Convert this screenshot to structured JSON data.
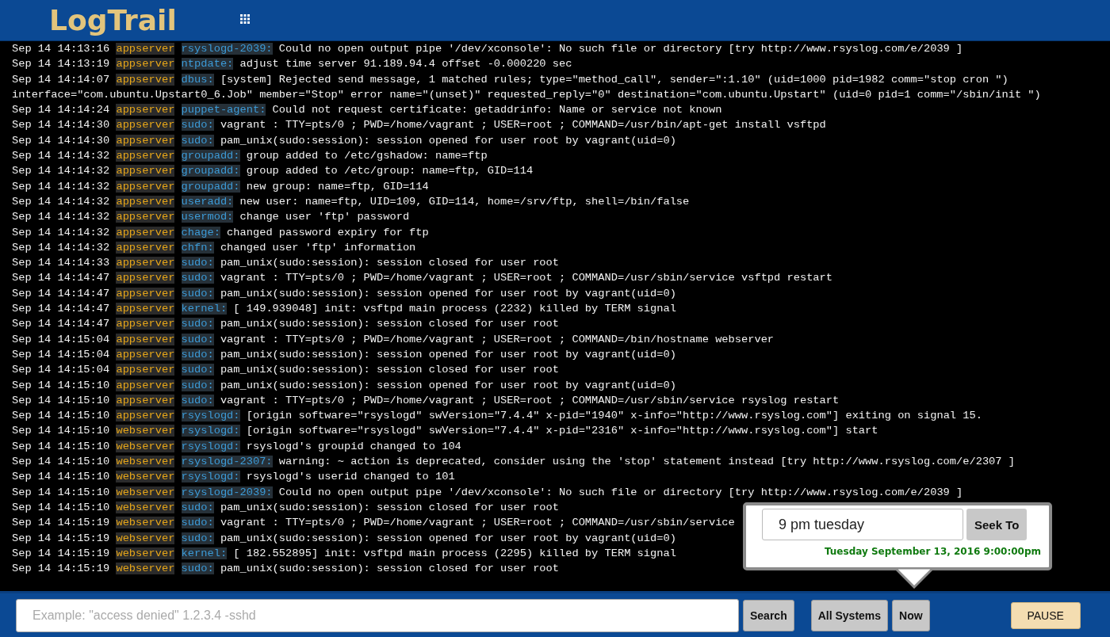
{
  "app": {
    "title": "LogTrail"
  },
  "log": [
    {
      "time": "Sep 14 14:13:16",
      "host": "appserver",
      "program": "rsyslogd-2039:",
      "message": "Could no open output pipe '/dev/xconsole': No such file or directory [try http://www.rsyslog.com/e/2039 ]"
    },
    {
      "time": "Sep 14 14:13:19",
      "host": "appserver",
      "program": "ntpdate:",
      "message": "adjust time server 91.189.94.4 offset -0.000220 sec"
    },
    {
      "time": "Sep 14 14:14:07",
      "host": "appserver",
      "program": "dbus:",
      "message": "[system] Rejected send message, 1 matched rules; type=\"method_call\", sender=\":1.10\" (uid=1000 pid=1982 comm=\"stop cron \")",
      "continuation": "interface=\"com.ubuntu.Upstart0_6.Job\" member=\"Stop\" error name=\"(unset)\" requested_reply=\"0\" destination=\"com.ubuntu.Upstart\" (uid=0 pid=1 comm=\"/sbin/init \")"
    },
    {
      "time": "Sep 14 14:14:24",
      "host": "appserver",
      "program": "puppet-agent:",
      "message": "Could not request certificate: getaddrinfo: Name or service not known"
    },
    {
      "time": "Sep 14 14:14:30",
      "host": "appserver",
      "program": "sudo:",
      "message": "vagrant : TTY=pts/0 ; PWD=/home/vagrant ; USER=root ; COMMAND=/usr/bin/apt-get install vsftpd"
    },
    {
      "time": "Sep 14 14:14:30",
      "host": "appserver",
      "program": "sudo:",
      "message": "pam_unix(sudo:session): session opened for user root by vagrant(uid=0)"
    },
    {
      "time": "Sep 14 14:14:32",
      "host": "appserver",
      "program": "groupadd:",
      "message": "group added to /etc/gshadow: name=ftp"
    },
    {
      "time": "Sep 14 14:14:32",
      "host": "appserver",
      "program": "groupadd:",
      "message": "group added to /etc/group: name=ftp, GID=114"
    },
    {
      "time": "Sep 14 14:14:32",
      "host": "appserver",
      "program": "groupadd:",
      "message": "new group: name=ftp, GID=114"
    },
    {
      "time": "Sep 14 14:14:32",
      "host": "appserver",
      "program": "useradd:",
      "message": "new user: name=ftp, UID=109, GID=114, home=/srv/ftp, shell=/bin/false"
    },
    {
      "time": "Sep 14 14:14:32",
      "host": "appserver",
      "program": "usermod:",
      "message": "change user 'ftp' password"
    },
    {
      "time": "Sep 14 14:14:32",
      "host": "appserver",
      "program": "chage:",
      "message": "changed password expiry for ftp"
    },
    {
      "time": "Sep 14 14:14:32",
      "host": "appserver",
      "program": "chfn:",
      "message": "changed user 'ftp' information"
    },
    {
      "time": "Sep 14 14:14:33",
      "host": "appserver",
      "program": "sudo:",
      "message": "pam_unix(sudo:session): session closed for user root"
    },
    {
      "time": "Sep 14 14:14:47",
      "host": "appserver",
      "program": "sudo:",
      "message": "vagrant : TTY=pts/0 ; PWD=/home/vagrant ; USER=root ; COMMAND=/usr/sbin/service vsftpd restart"
    },
    {
      "time": "Sep 14 14:14:47",
      "host": "appserver",
      "program": "sudo:",
      "message": "pam_unix(sudo:session): session opened for user root by vagrant(uid=0)"
    },
    {
      "time": "Sep 14 14:14:47",
      "host": "appserver",
      "program": "kernel:",
      "message": "[ 149.939048] init: vsftpd main process (2232) killed by TERM signal"
    },
    {
      "time": "Sep 14 14:14:47",
      "host": "appserver",
      "program": "sudo:",
      "message": "pam_unix(sudo:session): session closed for user root"
    },
    {
      "time": "Sep 14 14:15:04",
      "host": "appserver",
      "program": "sudo:",
      "message": "vagrant : TTY=pts/0 ; PWD=/home/vagrant ; USER=root ; COMMAND=/bin/hostname webserver"
    },
    {
      "time": "Sep 14 14:15:04",
      "host": "appserver",
      "program": "sudo:",
      "message": "pam_unix(sudo:session): session opened for user root by vagrant(uid=0)"
    },
    {
      "time": "Sep 14 14:15:04",
      "host": "appserver",
      "program": "sudo:",
      "message": "pam_unix(sudo:session): session closed for user root"
    },
    {
      "time": "Sep 14 14:15:10",
      "host": "appserver",
      "program": "sudo:",
      "message": "pam_unix(sudo:session): session opened for user root by vagrant(uid=0)"
    },
    {
      "time": "Sep 14 14:15:10",
      "host": "appserver",
      "program": "sudo:",
      "message": "vagrant : TTY=pts/0 ; PWD=/home/vagrant ; USER=root ; COMMAND=/usr/sbin/service rsyslog restart"
    },
    {
      "time": "Sep 14 14:15:10",
      "host": "appserver",
      "program": "rsyslogd:",
      "message": "[origin software=\"rsyslogd\" swVersion=\"7.4.4\" x-pid=\"1940\" x-info=\"http://www.rsyslog.com\"] exiting on signal 15."
    },
    {
      "time": "Sep 14 14:15:10",
      "host": "webserver",
      "program": "rsyslogd:",
      "message": "[origin software=\"rsyslogd\" swVersion=\"7.4.4\" x-pid=\"2316\" x-info=\"http://www.rsyslog.com\"] start"
    },
    {
      "time": "Sep 14 14:15:10",
      "host": "webserver",
      "program": "rsyslogd:",
      "message": "rsyslogd's groupid changed to 104"
    },
    {
      "time": "Sep 14 14:15:10",
      "host": "webserver",
      "program": "rsyslogd-2307:",
      "message": "warning: ~ action is deprecated, consider using the 'stop' statement instead [try http://www.rsyslog.com/e/2307 ]"
    },
    {
      "time": "Sep 14 14:15:10",
      "host": "webserver",
      "program": "rsyslogd:",
      "message": "rsyslogd's userid changed to 101"
    },
    {
      "time": "Sep 14 14:15:10",
      "host": "webserver",
      "program": "rsyslogd-2039:",
      "message": "Could no open output pipe '/dev/xconsole': No such file or directory [try http://www.rsyslog.com/e/2039 ]"
    },
    {
      "time": "Sep 14 14:15:10",
      "host": "webserver",
      "program": "sudo:",
      "message": "pam_unix(sudo:session): session closed for user root"
    },
    {
      "time": "Sep 14 14:15:19",
      "host": "webserver",
      "program": "sudo:",
      "message": "vagrant : TTY=pts/0 ; PWD=/home/vagrant ; USER=root ; COMMAND=/usr/sbin/service"
    },
    {
      "time": "Sep 14 14:15:19",
      "host": "webserver",
      "program": "sudo:",
      "message": "pam_unix(sudo:session): session opened for user root by vagrant(uid=0)"
    },
    {
      "time": "Sep 14 14:15:19",
      "host": "webserver",
      "program": "kernel:",
      "message": "[ 182.552895] init: vsftpd main process (2295) killed by TERM signal"
    },
    {
      "time": "Sep 14 14:15:19",
      "host": "webserver",
      "program": "sudo:",
      "message": "pam_unix(sudo:session): session closed for user root"
    }
  ],
  "seek": {
    "value": "9 pm tuesday",
    "button": "Seek To",
    "resolved": "Tuesday September 13, 2016 9:00:00pm"
  },
  "footer": {
    "search_placeholder": "Example: \"access denied\" 1.2.3.4 -sshd",
    "search_button": "Search",
    "systems_button": "All Systems",
    "now_button": "Now",
    "pause_button": "PAUSE"
  }
}
